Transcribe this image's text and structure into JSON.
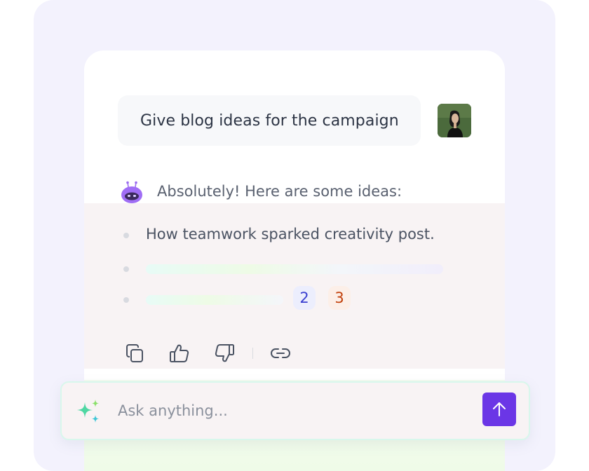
{
  "chat": {
    "user_message": "Give blog ideas for the campaign",
    "bot_reply_intro": "Absolutely! Here are some ideas:",
    "ideas": [
      "How teamwork sparked creativity post."
    ],
    "citation_badges": [
      "2",
      "3"
    ]
  },
  "actions": {
    "icons": [
      "copy-icon",
      "thumbs-up-icon",
      "thumbs-down-icon",
      "link-icon"
    ]
  },
  "composer": {
    "placeholder": "Ask anything...",
    "send_icon": "arrow-up-icon",
    "sparkle_icon": "sparkle-icon"
  },
  "colors": {
    "accent": "#6b36e6",
    "background": "#f3f2fd",
    "bot_icon": "#9b6cf0"
  }
}
